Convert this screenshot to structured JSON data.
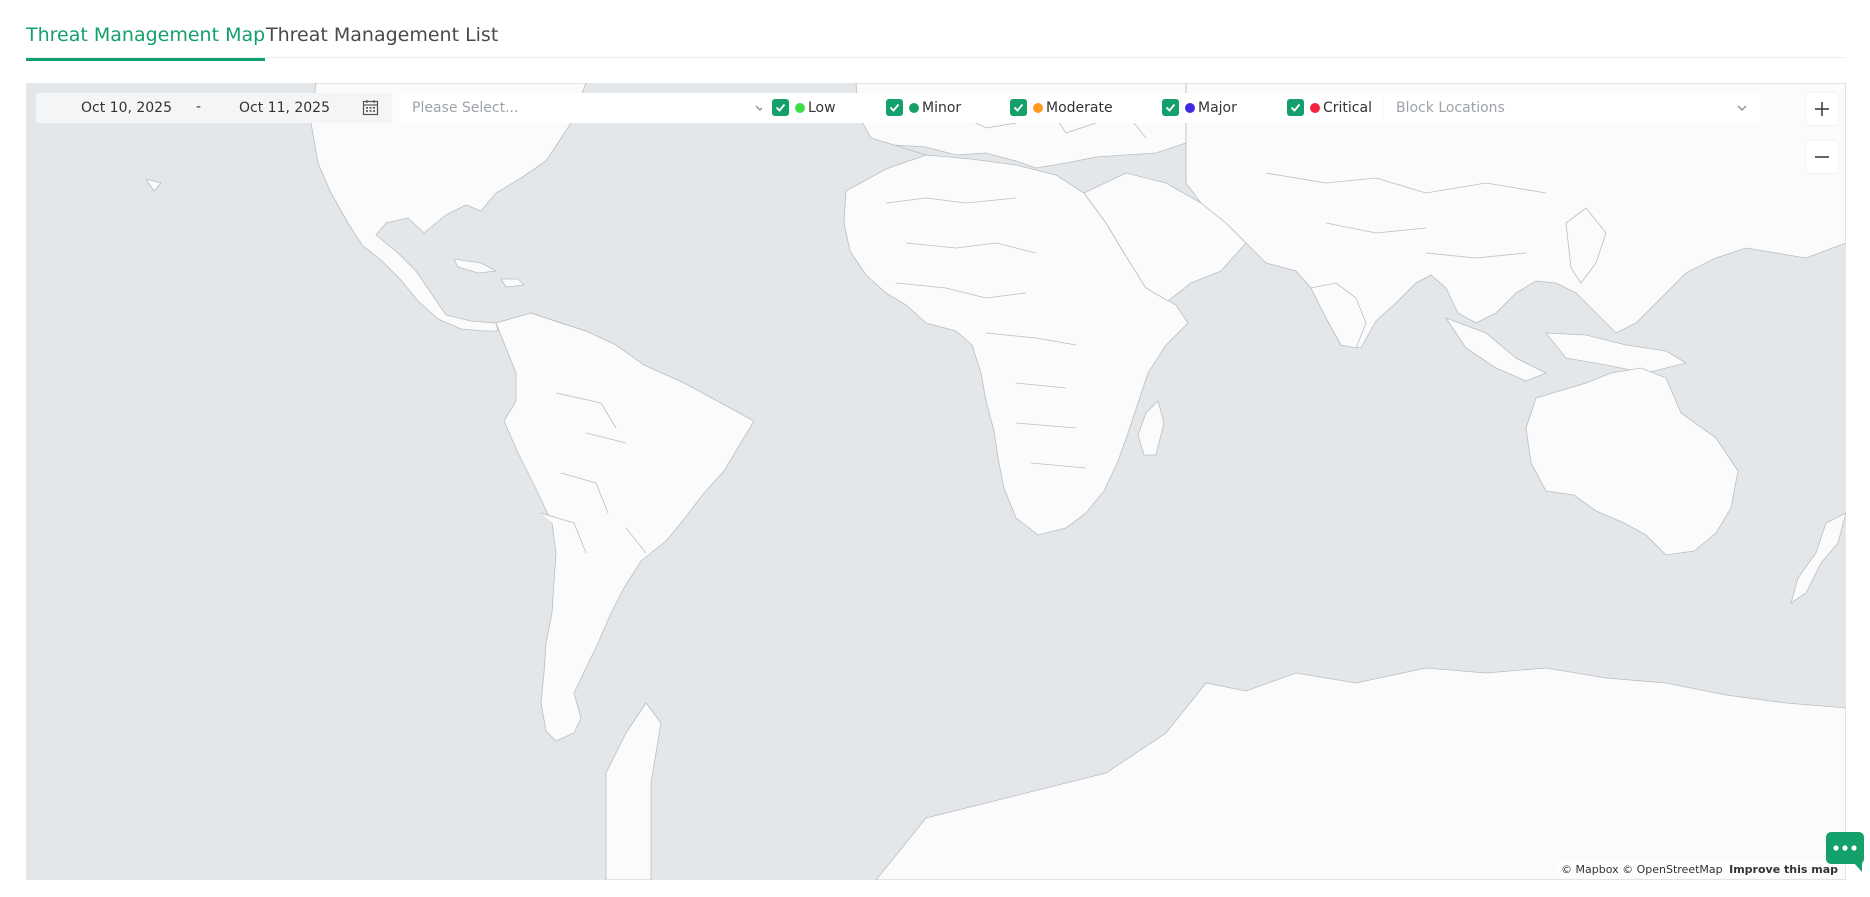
{
  "tabs": [
    {
      "label": "Threat Management Map",
      "active": true
    },
    {
      "label": "Threat Management List",
      "active": false
    }
  ],
  "filters": {
    "date_from": "Oct 10, 2025",
    "date_separator": "-",
    "date_to": "Oct 11, 2025",
    "category_placeholder": "Please Select...",
    "block_locations_placeholder": "Block Locations",
    "severity": [
      {
        "label": "Low",
        "color": "#3fdc47",
        "checked": true
      },
      {
        "label": "Minor",
        "color": "#14a06b",
        "checked": true
      },
      {
        "label": "Moderate",
        "color": "#ff9a1f",
        "checked": true
      },
      {
        "label": "Major",
        "color": "#3f2be0",
        "checked": true
      },
      {
        "label": "Critical",
        "color": "#f0243f",
        "checked": true
      }
    ]
  },
  "map": {
    "attribution": {
      "mapbox": "© Mapbox",
      "osm": "© OpenStreetMap",
      "improve": "Improve this map"
    },
    "icons": {
      "zoom_in": "plus-icon",
      "zoom_out": "minus-icon",
      "calendar": "calendar-icon",
      "chat": "chat-icon"
    }
  },
  "colors": {
    "accent": "#14a06b",
    "map_water": "#e4e7ea",
    "map_land": "#fbfbfb"
  }
}
